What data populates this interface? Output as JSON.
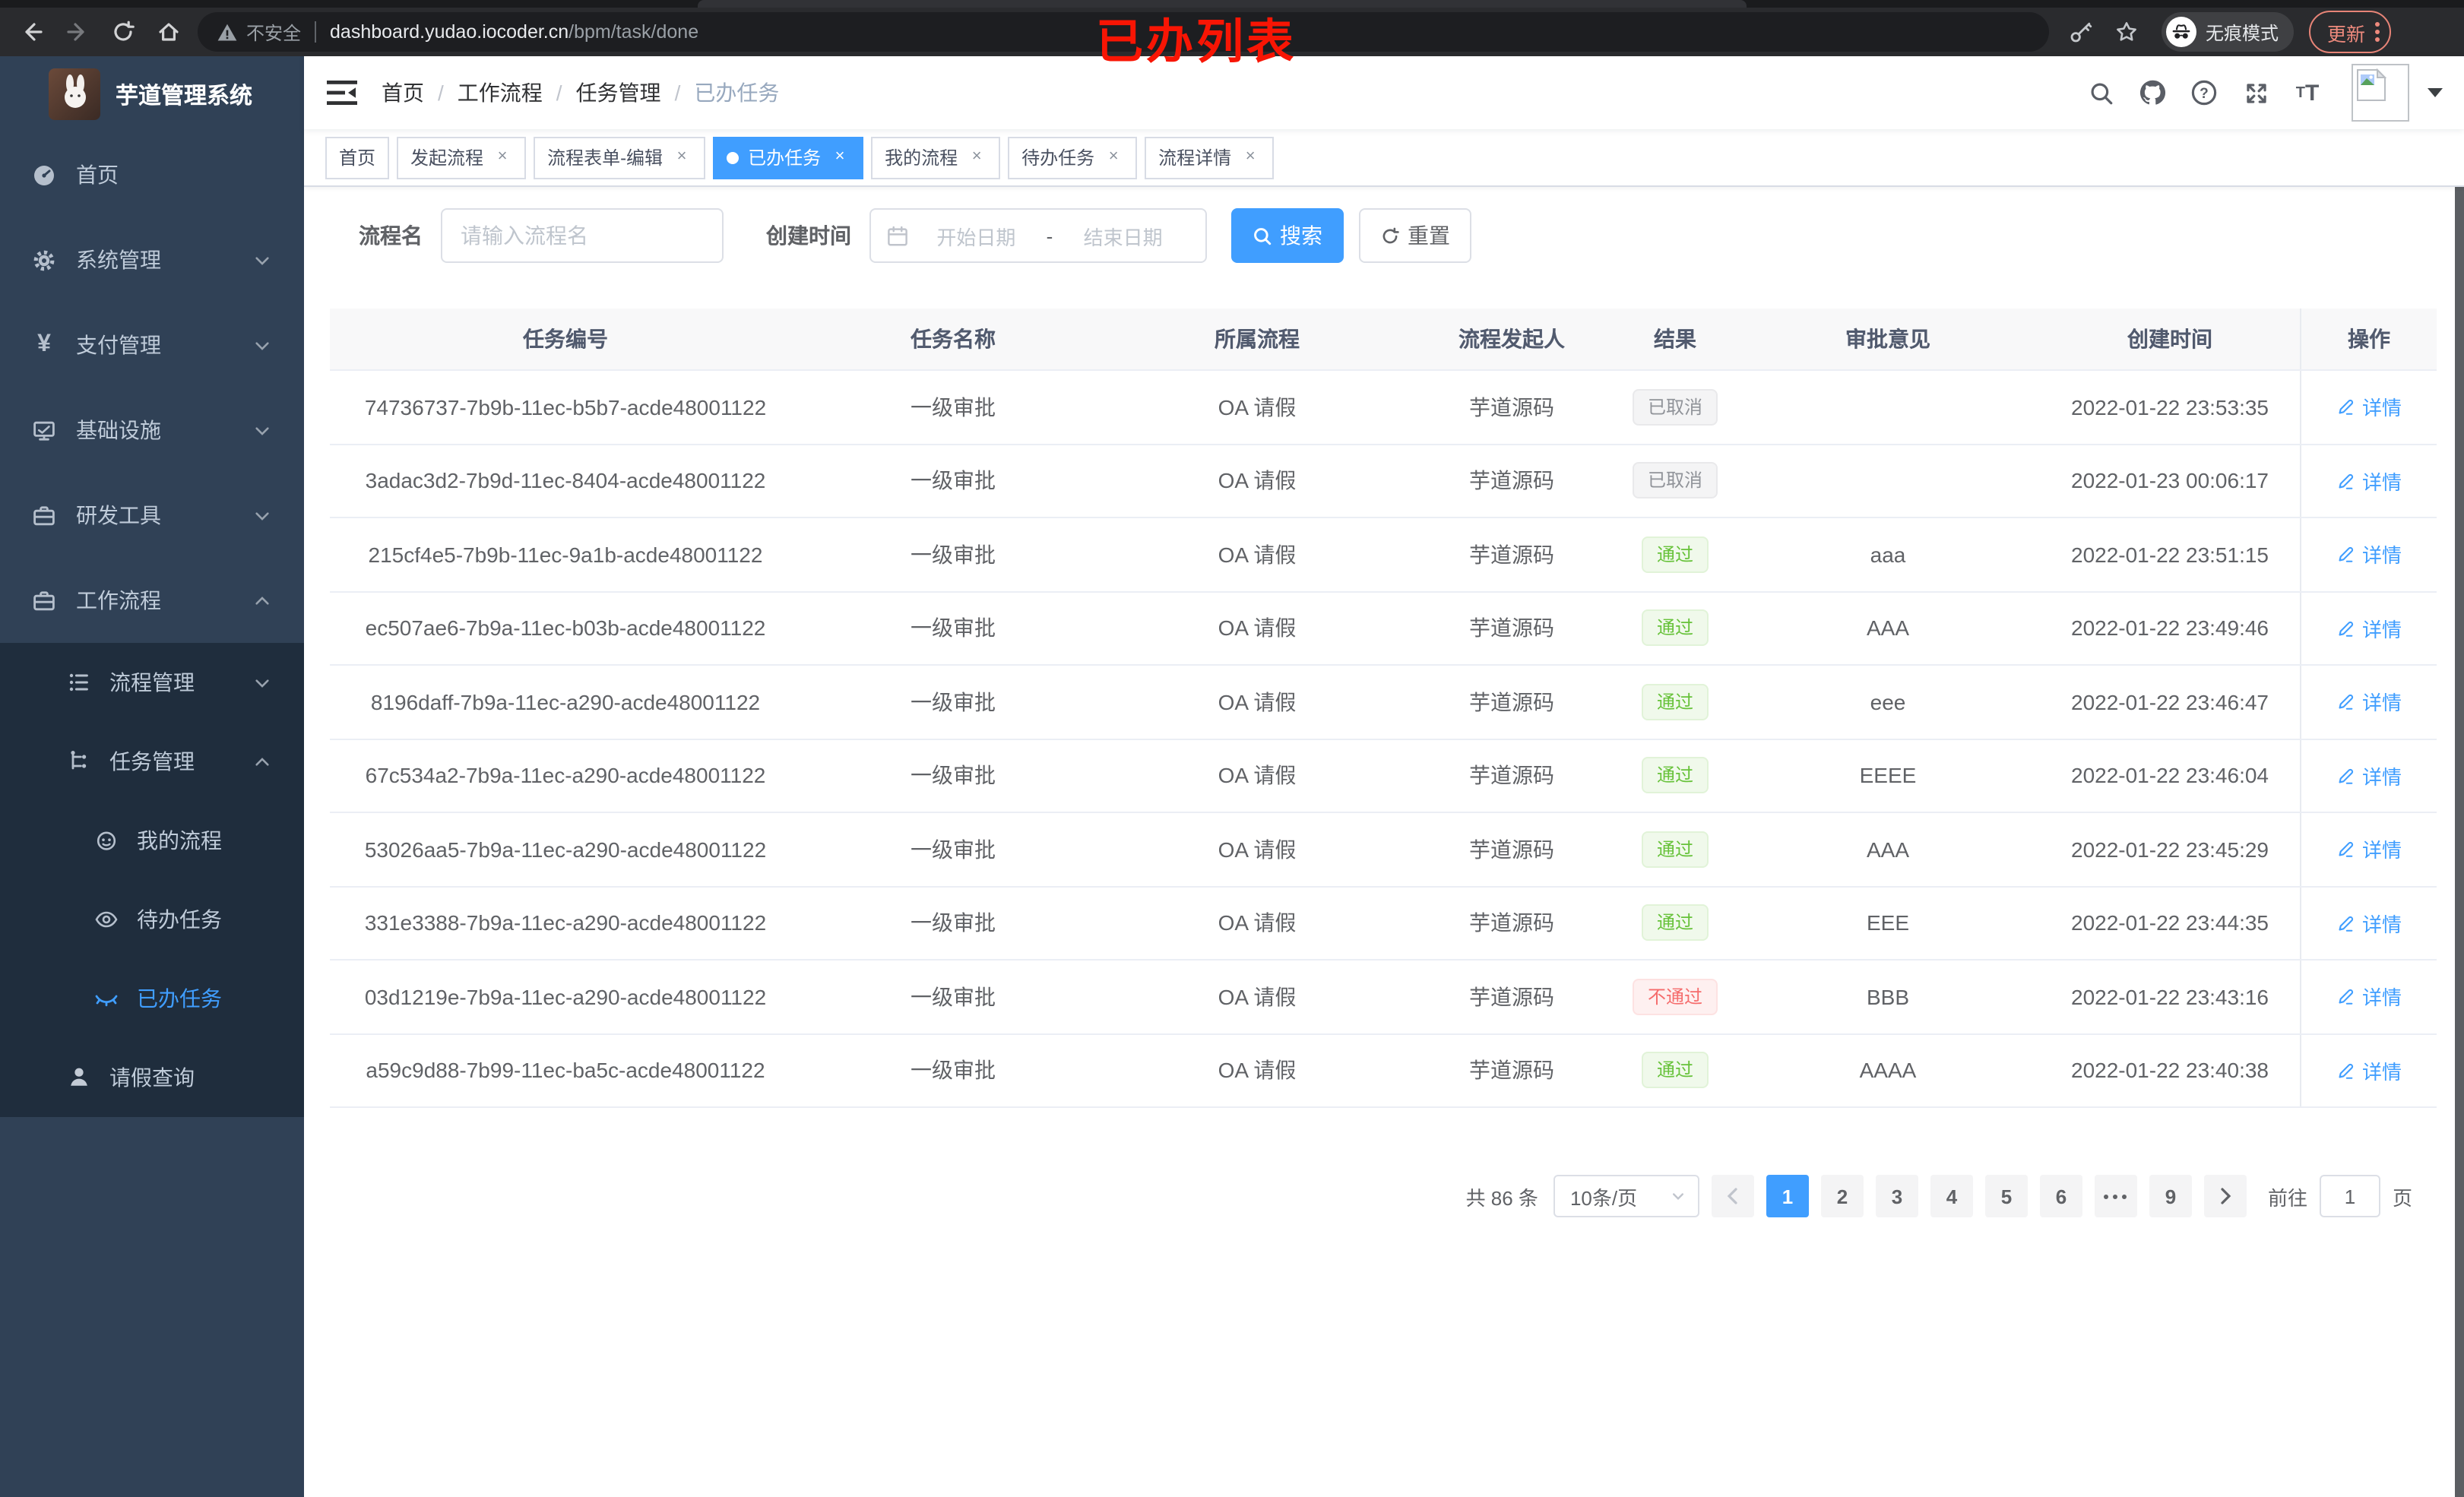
{
  "annotation": {
    "text": "已办列表",
    "color": "#f81504"
  },
  "browser": {
    "security_label": "不安全",
    "url_host": "dashboard.yudao.iocoder.cn",
    "url_path": "/bpm/task/done",
    "incognito_label": "无痕模式",
    "update_label": "更新"
  },
  "sidebar": {
    "title": "芋道管理系统",
    "items": [
      {
        "label": "首页"
      },
      {
        "label": "系统管理"
      },
      {
        "label": "支付管理"
      },
      {
        "label": "基础设施"
      },
      {
        "label": "研发工具"
      },
      {
        "label": "工作流程"
      },
      {
        "label": "流程管理"
      },
      {
        "label": "任务管理"
      },
      {
        "label": "我的流程"
      },
      {
        "label": "待办任务"
      },
      {
        "label": "已办任务"
      },
      {
        "label": "请假查询"
      }
    ]
  },
  "breadcrumb": {
    "items": [
      "首页",
      "工作流程",
      "任务管理",
      "已办任务"
    ]
  },
  "tabs": [
    {
      "label": "首页"
    },
    {
      "label": "发起流程"
    },
    {
      "label": "流程表单-编辑"
    },
    {
      "label": "已办任务"
    },
    {
      "label": "我的流程"
    },
    {
      "label": "待办任务"
    },
    {
      "label": "流程详情"
    }
  ],
  "filters": {
    "name_label": "流程名",
    "name_placeholder": "请输入流程名",
    "time_label": "创建时间",
    "start_placeholder": "开始日期",
    "range_separator": "-",
    "end_placeholder": "结束日期",
    "search_label": "搜索",
    "reset_label": "重置"
  },
  "table": {
    "columns": [
      "任务编号",
      "任务名称",
      "所属流程",
      "流程发起人",
      "结果",
      "审批意见",
      "创建时间",
      "操作"
    ],
    "action_label": "详情",
    "rows": [
      {
        "id": "74736737-7b9b-11ec-b5b7-acde48001122",
        "name": "一级审批",
        "process": "OA 请假",
        "starter": "芋道源码",
        "result": "已取消",
        "result_type": "info",
        "opinion": "",
        "time": "2022-01-22 23:53:35"
      },
      {
        "id": "3adac3d2-7b9d-11ec-8404-acde48001122",
        "name": "一级审批",
        "process": "OA 请假",
        "starter": "芋道源码",
        "result": "已取消",
        "result_type": "info",
        "opinion": "",
        "time": "2022-01-23 00:06:17"
      },
      {
        "id": "215cf4e5-7b9b-11ec-9a1b-acde48001122",
        "name": "一级审批",
        "process": "OA 请假",
        "starter": "芋道源码",
        "result": "通过",
        "result_type": "success",
        "opinion": "aaa",
        "time": "2022-01-22 23:51:15"
      },
      {
        "id": "ec507ae6-7b9a-11ec-b03b-acde48001122",
        "name": "一级审批",
        "process": "OA 请假",
        "starter": "芋道源码",
        "result": "通过",
        "result_type": "success",
        "opinion": "AAA",
        "time": "2022-01-22 23:49:46"
      },
      {
        "id": "8196daff-7b9a-11ec-a290-acde48001122",
        "name": "一级审批",
        "process": "OA 请假",
        "starter": "芋道源码",
        "result": "通过",
        "result_type": "success",
        "opinion": "eee",
        "time": "2022-01-22 23:46:47"
      },
      {
        "id": "67c534a2-7b9a-11ec-a290-acde48001122",
        "name": "一级审批",
        "process": "OA 请假",
        "starter": "芋道源码",
        "result": "通过",
        "result_type": "success",
        "opinion": "EEEE",
        "time": "2022-01-22 23:46:04"
      },
      {
        "id": "53026aa5-7b9a-11ec-a290-acde48001122",
        "name": "一级审批",
        "process": "OA 请假",
        "starter": "芋道源码",
        "result": "通过",
        "result_type": "success",
        "opinion": "AAA",
        "time": "2022-01-22 23:45:29"
      },
      {
        "id": "331e3388-7b9a-11ec-a290-acde48001122",
        "name": "一级审批",
        "process": "OA 请假",
        "starter": "芋道源码",
        "result": "通过",
        "result_type": "success",
        "opinion": "EEE",
        "time": "2022-01-22 23:44:35"
      },
      {
        "id": "03d1219e-7b9a-11ec-a290-acde48001122",
        "name": "一级审批",
        "process": "OA 请假",
        "starter": "芋道源码",
        "result": "不通过",
        "result_type": "danger",
        "opinion": "BBB",
        "time": "2022-01-22 23:43:16"
      },
      {
        "id": "a59c9d88-7b99-11ec-ba5c-acde48001122",
        "name": "一级审批",
        "process": "OA 请假",
        "starter": "芋道源码",
        "result": "通过",
        "result_type": "success",
        "opinion": "AAAA",
        "time": "2022-01-22 23:40:38"
      }
    ]
  },
  "pagination": {
    "total_label": "共 86 条",
    "page_size": "10条/页",
    "pages": [
      "1",
      "2",
      "3",
      "4",
      "5",
      "6"
    ],
    "active_page": "1",
    "last_page": "9",
    "goto_label": "前往",
    "goto_value": "1",
    "goto_suffix": "页"
  },
  "colors": {
    "primary": "#409eff",
    "sidebar_bg": "#304156",
    "submenu_bg": "#1f2d3d",
    "success_text": "#67c23a",
    "danger_text": "#f56c6c",
    "info_text": "#909399"
  }
}
